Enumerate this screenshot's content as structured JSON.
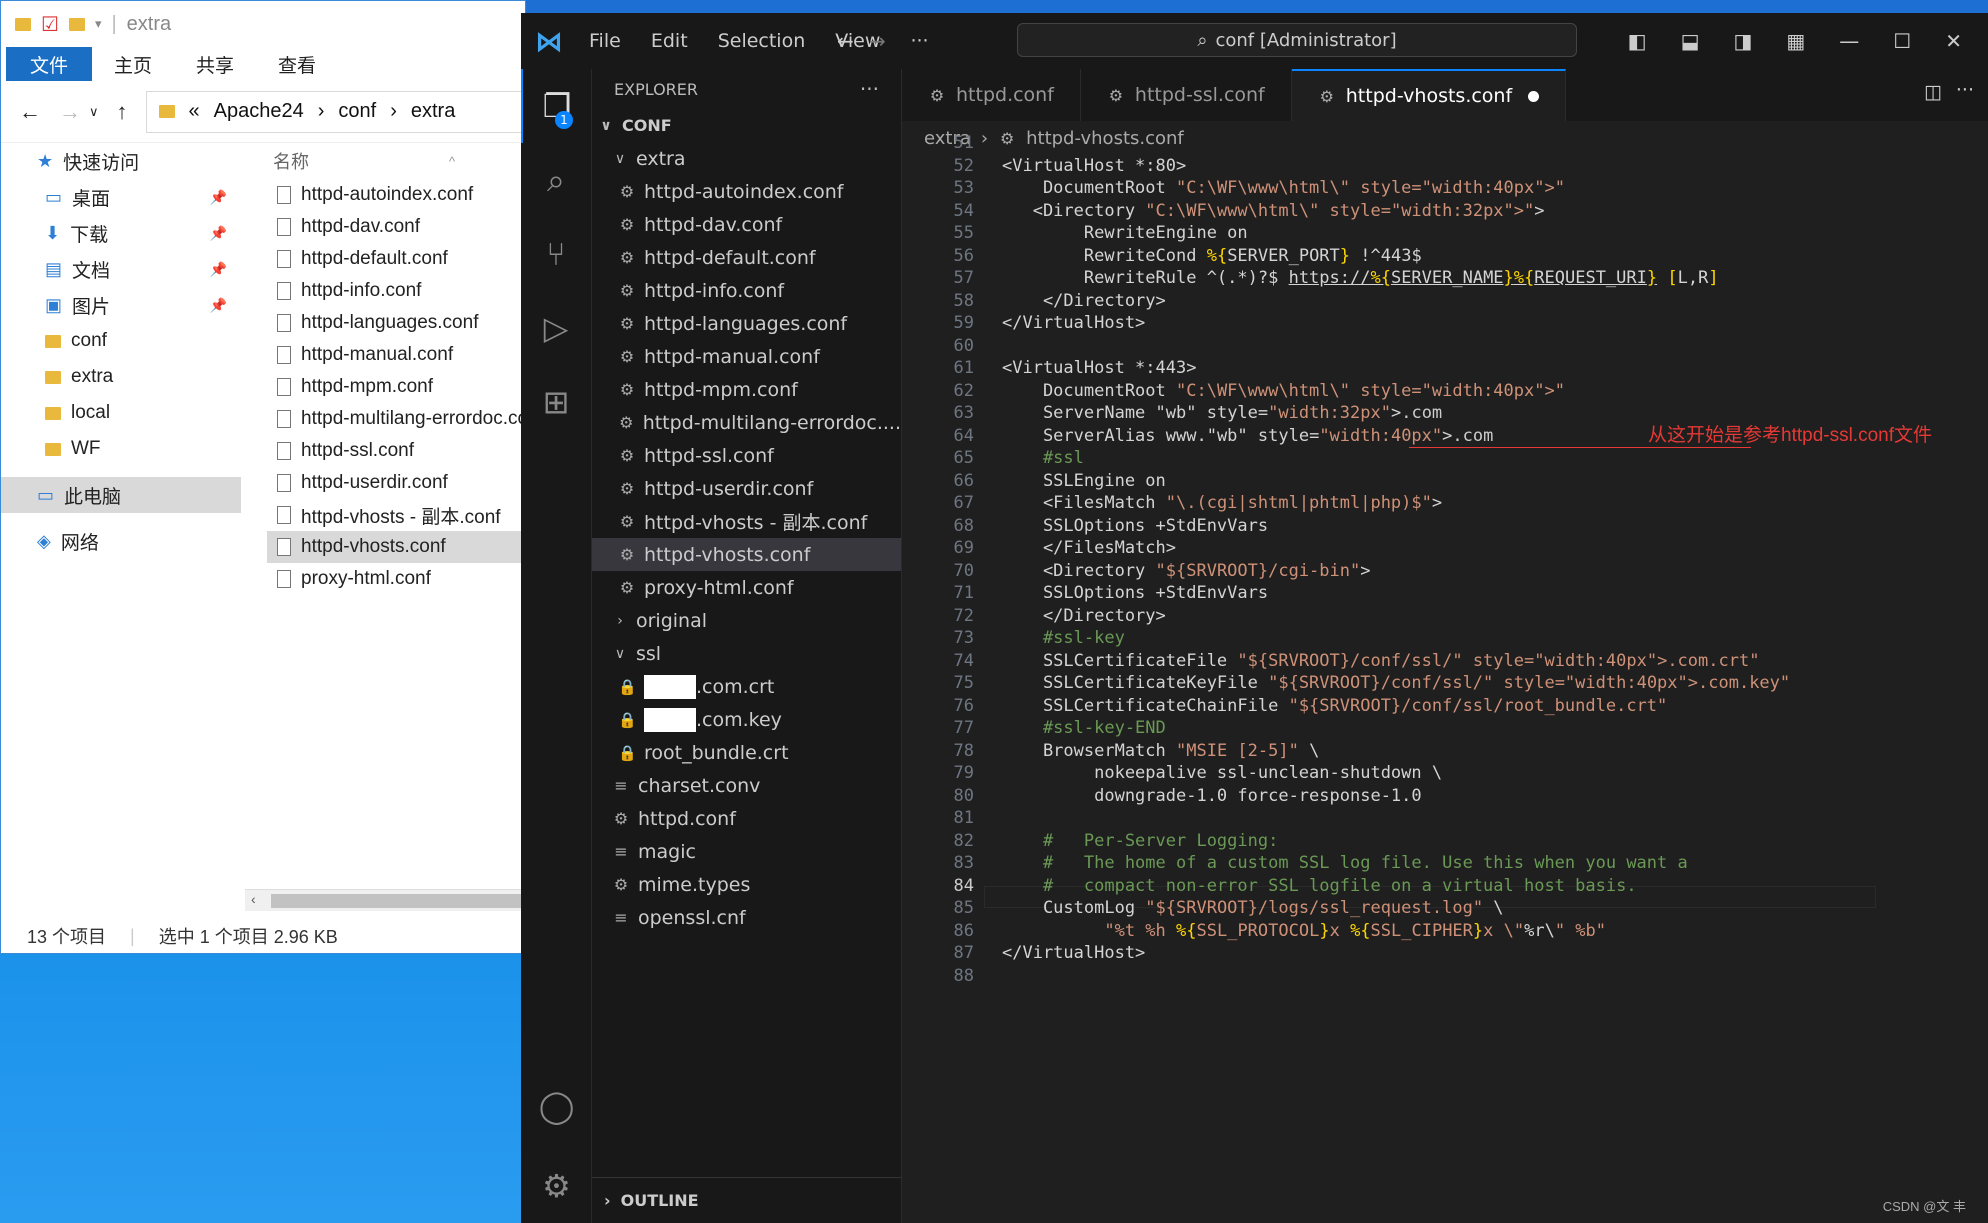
{
  "explorer": {
    "title": "extra",
    "ribbon_tabs": [
      "文件",
      "主页",
      "共享",
      "查看"
    ],
    "breadcrumb": [
      "Apache24",
      "conf",
      "extra"
    ],
    "nav_items": [
      {
        "label": "快速访问",
        "icon": "star-icon"
      },
      {
        "label": "桌面",
        "icon": "desktop-icon",
        "pinned": true
      },
      {
        "label": "下载",
        "icon": "download-icon",
        "pinned": true
      },
      {
        "label": "文档",
        "icon": "document-icon",
        "pinned": true
      },
      {
        "label": "图片",
        "icon": "picture-icon",
        "pinned": true
      },
      {
        "label": "conf",
        "icon": "folder-icon"
      },
      {
        "label": "extra",
        "icon": "folder-icon"
      },
      {
        "label": "local",
        "icon": "folder-icon"
      },
      {
        "label": "WF",
        "icon": "folder-icon"
      },
      {
        "label": "此电脑",
        "icon": "computer-icon",
        "selected": true
      },
      {
        "label": "网络",
        "icon": "network-icon"
      }
    ],
    "column_header": "名称",
    "files": [
      "httpd-autoindex.conf",
      "httpd-dav.conf",
      "httpd-default.conf",
      "httpd-info.conf",
      "httpd-languages.conf",
      "httpd-manual.conf",
      "httpd-mpm.conf",
      "httpd-multilang-errordoc.conf",
      "httpd-ssl.conf",
      "httpd-userdir.conf",
      "httpd-vhosts - 副本.conf",
      "httpd-vhosts.conf",
      "proxy-html.conf"
    ],
    "selected_file": "httpd-vhosts.conf",
    "status_count": "13 个项目",
    "status_selected": "选中 1 个项目  2.96 KB"
  },
  "vscode": {
    "menu": [
      "File",
      "Edit",
      "Selection",
      "View",
      "···"
    ],
    "command_center": "conf [Administrator]",
    "explorer_title": "EXPLORER",
    "root_folder": "CONF",
    "tree": [
      {
        "label": "extra",
        "type": "folder-open",
        "depth": 1
      },
      {
        "label": "httpd-autoindex.conf",
        "type": "gear",
        "depth": 2
      },
      {
        "label": "httpd-dav.conf",
        "type": "gear",
        "depth": 2
      },
      {
        "label": "httpd-default.conf",
        "type": "gear",
        "depth": 2
      },
      {
        "label": "httpd-info.conf",
        "type": "gear",
        "depth": 2
      },
      {
        "label": "httpd-languages.conf",
        "type": "gear",
        "depth": 2
      },
      {
        "label": "httpd-manual.conf",
        "type": "gear",
        "depth": 2
      },
      {
        "label": "httpd-mpm.conf",
        "type": "gear",
        "depth": 2
      },
      {
        "label": "httpd-multilang-errordoc....",
        "type": "gear",
        "depth": 2
      },
      {
        "label": "httpd-ssl.conf",
        "type": "gear",
        "depth": 2
      },
      {
        "label": "httpd-userdir.conf",
        "type": "gear",
        "depth": 2
      },
      {
        "label": "httpd-vhosts - 副本.conf",
        "type": "gear",
        "depth": 2
      },
      {
        "label": "httpd-vhosts.conf",
        "type": "gear",
        "depth": 2,
        "selected": true
      },
      {
        "label": "proxy-html.conf",
        "type": "gear",
        "depth": 2
      },
      {
        "label": "original",
        "type": "folder-closed",
        "depth": 1
      },
      {
        "label": "ssl",
        "type": "folder-open",
        "depth": 1
      },
      {
        "label": ".com.crt",
        "type": "lock-redacted",
        "depth": 2
      },
      {
        "label": ".com.key",
        "type": "lock-redacted",
        "depth": 2
      },
      {
        "label": "root_bundle.crt",
        "type": "lock",
        "depth": 2
      },
      {
        "label": "charset.conv",
        "type": "lines",
        "depth": 1
      },
      {
        "label": "httpd.conf",
        "type": "gear",
        "depth": 1
      },
      {
        "label": "magic",
        "type": "lines",
        "depth": 1
      },
      {
        "label": "mime.types",
        "type": "gear",
        "depth": 1
      },
      {
        "label": "openssl.cnf",
        "type": "lines",
        "depth": 1
      }
    ],
    "outline_label": "OUTLINE",
    "tabs": [
      {
        "label": "httpd.conf",
        "active": false
      },
      {
        "label": "httpd-ssl.conf",
        "active": false
      },
      {
        "label": "httpd-vhosts.conf",
        "active": true,
        "dirty": true
      }
    ],
    "breadcrumb": [
      "extra",
      "httpd-vhosts.conf"
    ],
    "current_line": 84,
    "annotation": "从这开始是参考httpd-ssl.conf文件",
    "watermark": "CSDN @文 丰",
    "code_lines": [
      {
        "n": 51,
        "text": ""
      },
      {
        "n": 52,
        "text": "<VirtualHost *:80>"
      },
      {
        "n": 53,
        "text": "    DocumentRoot \"C:\\WF\\www\\html\\█████\""
      },
      {
        "n": 54,
        "text": "   <Directory \"C:\\WF\\www\\html\\████\">"
      },
      {
        "n": 55,
        "text": "        RewriteEngine on"
      },
      {
        "n": 56,
        "text": "        RewriteCond %{SERVER_PORT} !^443$"
      },
      {
        "n": 57,
        "text": "        RewriteRule ^(.*)?$ https://%{SERVER_NAME}%{REQUEST_URI} [L,R]"
      },
      {
        "n": 58,
        "text": "    </Directory>"
      },
      {
        "n": 59,
        "text": "</VirtualHost>"
      },
      {
        "n": 60,
        "text": ""
      },
      {
        "n": 61,
        "text": "<VirtualHost *:443>"
      },
      {
        "n": 62,
        "text": "    DocumentRoot \"C:\\WF\\www\\html\\█████\""
      },
      {
        "n": 63,
        "text": "    ServerName ████.com"
      },
      {
        "n": 64,
        "text": "    ServerAlias www.█████.com"
      },
      {
        "n": 65,
        "text": "    #ssl"
      },
      {
        "n": 66,
        "text": "    SSLEngine on"
      },
      {
        "n": 67,
        "text": "    <FilesMatch \"\\.(cgi|shtml|phtml|php)$\">"
      },
      {
        "n": 68,
        "text": "    SSLOptions +StdEnvVars"
      },
      {
        "n": 69,
        "text": "    </FilesMatch>"
      },
      {
        "n": 70,
        "text": "    <Directory \"${SRVROOT}/cgi-bin\">"
      },
      {
        "n": 71,
        "text": "    SSLOptions +StdEnvVars"
      },
      {
        "n": 72,
        "text": "    </Directory>"
      },
      {
        "n": 73,
        "text": "    #ssl-key"
      },
      {
        "n": 74,
        "text": "    SSLCertificateFile \"${SRVROOT}/conf/ssl/█████.com.crt\""
      },
      {
        "n": 75,
        "text": "    SSLCertificateKeyFile \"${SRVROOT}/conf/ssl/█████.com.key\""
      },
      {
        "n": 76,
        "text": "    SSLCertificateChainFile \"${SRVROOT}/conf/ssl/root_bundle.crt\""
      },
      {
        "n": 77,
        "text": "    #ssl-key-END"
      },
      {
        "n": 78,
        "text": "    BrowserMatch \"MSIE [2-5]\" \\"
      },
      {
        "n": 79,
        "text": "         nokeepalive ssl-unclean-shutdown \\"
      },
      {
        "n": 80,
        "text": "         downgrade-1.0 force-response-1.0"
      },
      {
        "n": 81,
        "text": ""
      },
      {
        "n": 82,
        "text": "    #   Per-Server Logging:"
      },
      {
        "n": 83,
        "text": "    #   The home of a custom SSL log file. Use this when you want a"
      },
      {
        "n": 84,
        "text": "    #   compact non-error SSL logfile on a virtual host basis."
      },
      {
        "n": 85,
        "text": "    CustomLog \"${SRVROOT}/logs/ssl_request.log\" \\"
      },
      {
        "n": 86,
        "text": "          \"%t %h %{SSL_PROTOCOL}x %{SSL_CIPHER}x \\\"%r\\\" %b\""
      },
      {
        "n": 87,
        "text": "</VirtualHost>"
      },
      {
        "n": 88,
        "text": ""
      }
    ]
  }
}
